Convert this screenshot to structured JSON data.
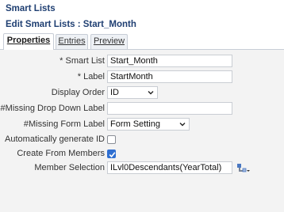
{
  "app_title": "Smart Lists",
  "page_title": "Edit Smart Lists : Start_Month",
  "tabs": [
    {
      "label": "Properties",
      "active": true
    },
    {
      "label": "Entries",
      "active": false
    },
    {
      "label": "Preview",
      "active": false
    }
  ],
  "form": {
    "smart_list": {
      "label": "* Smart List",
      "value": "Start_Month"
    },
    "label": {
      "label": "* Label",
      "value": "StartMonth"
    },
    "display_order": {
      "label": "Display Order",
      "value": "ID"
    },
    "missing_drop_down_label": {
      "label": "#Missing Drop Down Label",
      "value": ""
    },
    "missing_form_label": {
      "label": "#Missing Form Label",
      "value": "Form Setting"
    },
    "auto_generate_id": {
      "label": "Automatically generate ID",
      "checked": false
    },
    "create_from_members": {
      "label": "Create From Members",
      "checked": true
    },
    "member_selection": {
      "label": "Member Selection",
      "value": "ILvl0Descendants(YearTotal)",
      "icon": "member-selector-icon"
    }
  },
  "colors": {
    "title": "#1f3f72",
    "panel_bg": "#f3f3f3",
    "checkbox_checked": "#2f6fd1"
  }
}
